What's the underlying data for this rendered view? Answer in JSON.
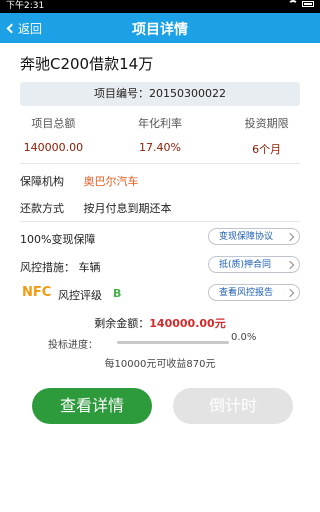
{
  "status": {
    "time": "下午2:31"
  },
  "nav": {
    "back_label": "返回",
    "title": "项目详情"
  },
  "product": {
    "title": "奔驰C200借款14万",
    "code_label": "项目编号：20150300022"
  },
  "summary": {
    "headers": [
      "项目总额",
      "年化利率",
      "投资期限"
    ],
    "values": [
      "140000.00",
      "17.40%",
      "6个月"
    ]
  },
  "details": {
    "guarantee_key": "保障机构",
    "guarantee_val": "奥巴尔汽车",
    "repay_key": "还款方式",
    "repay_val": "按月付息到期还本"
  },
  "protection": {
    "label": "100%变现保障",
    "link": "变现保障协议"
  },
  "risk_measure": {
    "label": "风控措施：  车辆",
    "link": "抵(质)押合同"
  },
  "risk_rating": {
    "badge": "NFC",
    "label": "风控评级",
    "grade": "B",
    "link": "查看风控报告"
  },
  "remaining": {
    "label": "剩余金额：",
    "amount": "140000.00元"
  },
  "progress": {
    "label": "投标进度：",
    "percent_text": "0.0%",
    "value": 0.0
  },
  "earnings": {
    "text": "每10000元可收益870元"
  },
  "buttons": {
    "view": "查看详情",
    "countdown": "倒计时"
  },
  "colors": {
    "nav": "#1da1e6",
    "primary_button": "#2d9a3b",
    "disabled_button": "#e3e3e3",
    "amount_red": "#d42a2a"
  }
}
